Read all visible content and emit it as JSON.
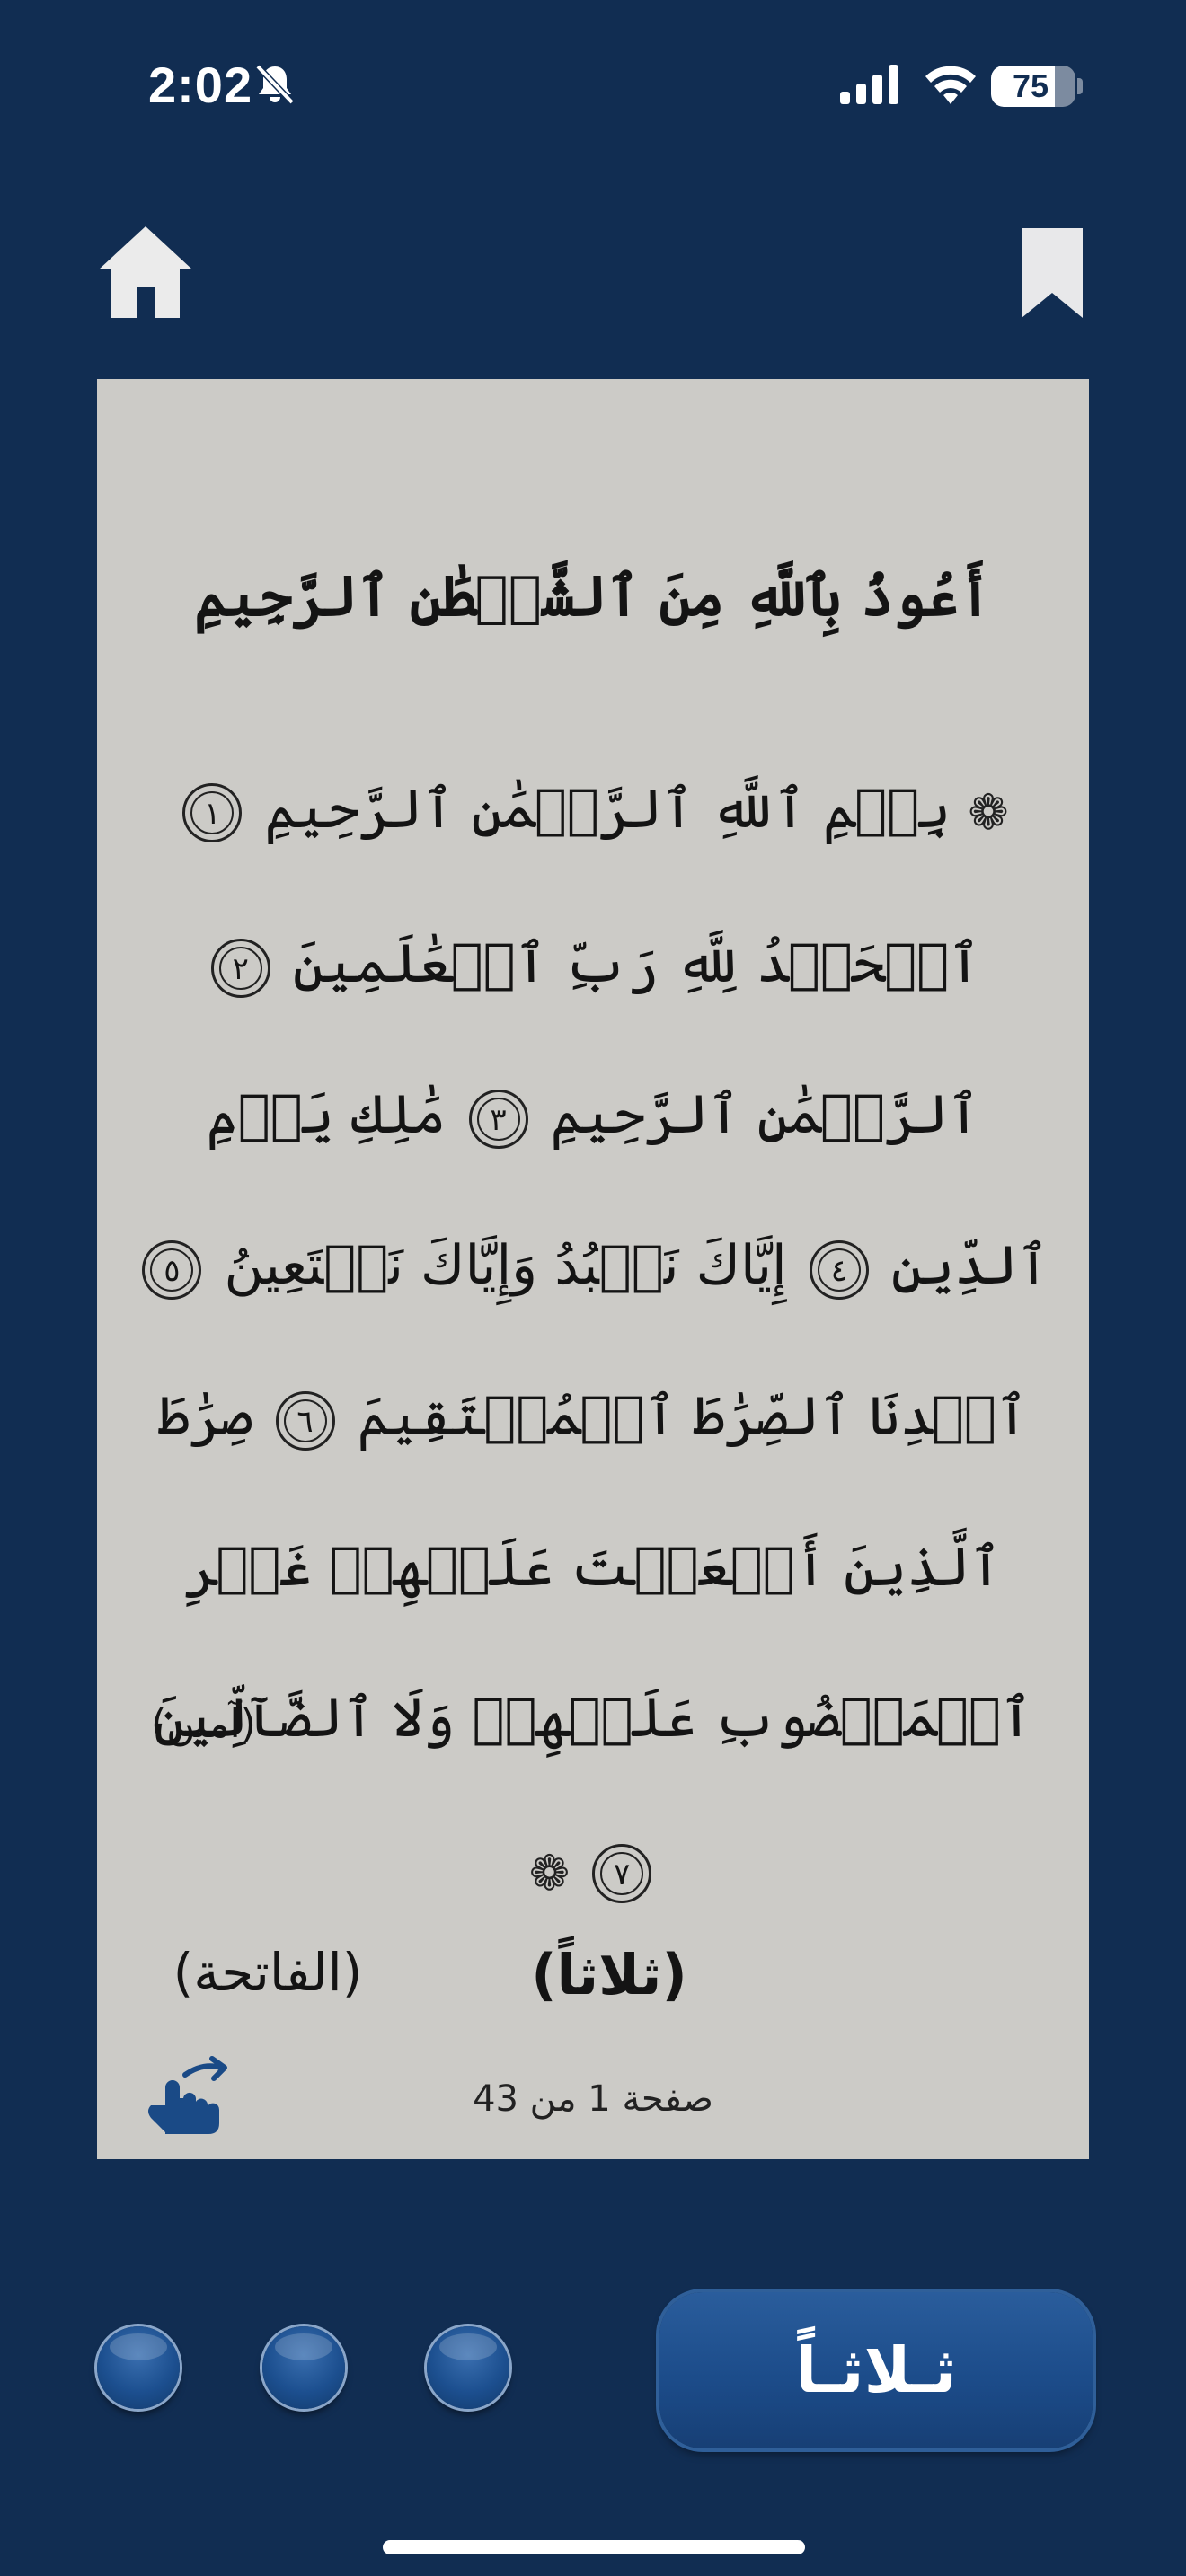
{
  "status_bar": {
    "time": "2:02",
    "battery_level": "75",
    "battery_fraction": 0.75
  },
  "header": {
    "home_icon": "home-icon",
    "bookmark_icon": "bookmark-icon"
  },
  "page": {
    "title": "أَعُوذُ بِٱللَّهِ مِنَ ٱلشَّيۡطَٰنِ ٱلرَّجِيمِ",
    "verses": [
      {
        "text": "بِسۡمِ ٱللَّهِ ٱلرَّحۡمَٰنِ ٱلرَّحِيمِ",
        "num": "١"
      },
      {
        "text": "ٱلۡحَمۡدُ لِلَّهِ رَبِّ ٱلۡعَٰلَمِينَ",
        "num": "٢"
      },
      {
        "text": "ٱلرَّحۡمَٰنِ ٱلرَّحِيمِ",
        "num": "٣"
      },
      {
        "text": "مَٰلِكِ يَوۡمِ ٱلدِّينِ",
        "num": "٤"
      },
      {
        "text": "إِيَّاكَ نَعۡبُدُ وَإِيَّاكَ نَسۡتَعِينُ",
        "num": "٥"
      },
      {
        "text": "ٱهۡدِنَا ٱلصِّرَٰطَ ٱلۡمُسۡتَقِيمَ",
        "num": "٦"
      },
      {
        "text": "صِرَٰطَ ٱلَّذِينَ أَنۡعَمۡتَ عَلَيۡهِمۡ غَيۡرِ ٱلۡمَغۡضُوبِ عَلَيۡهِمۡ وَلَا ٱلضَّآلِّينَ",
        "num": "٧"
      }
    ],
    "amin": "(آمين)",
    "repeat_count": "(ثلاثاً)",
    "surah_name": "(الفاتحة)",
    "page_indicator": "صفحة 1 من 43"
  },
  "controls": {
    "main_button_label": "ثـلاثـاً"
  },
  "colors": {
    "background": "#112d52",
    "card": "#cccbc7",
    "accent": "#1c4c8a",
    "icon_blue": "#1a4a86"
  }
}
